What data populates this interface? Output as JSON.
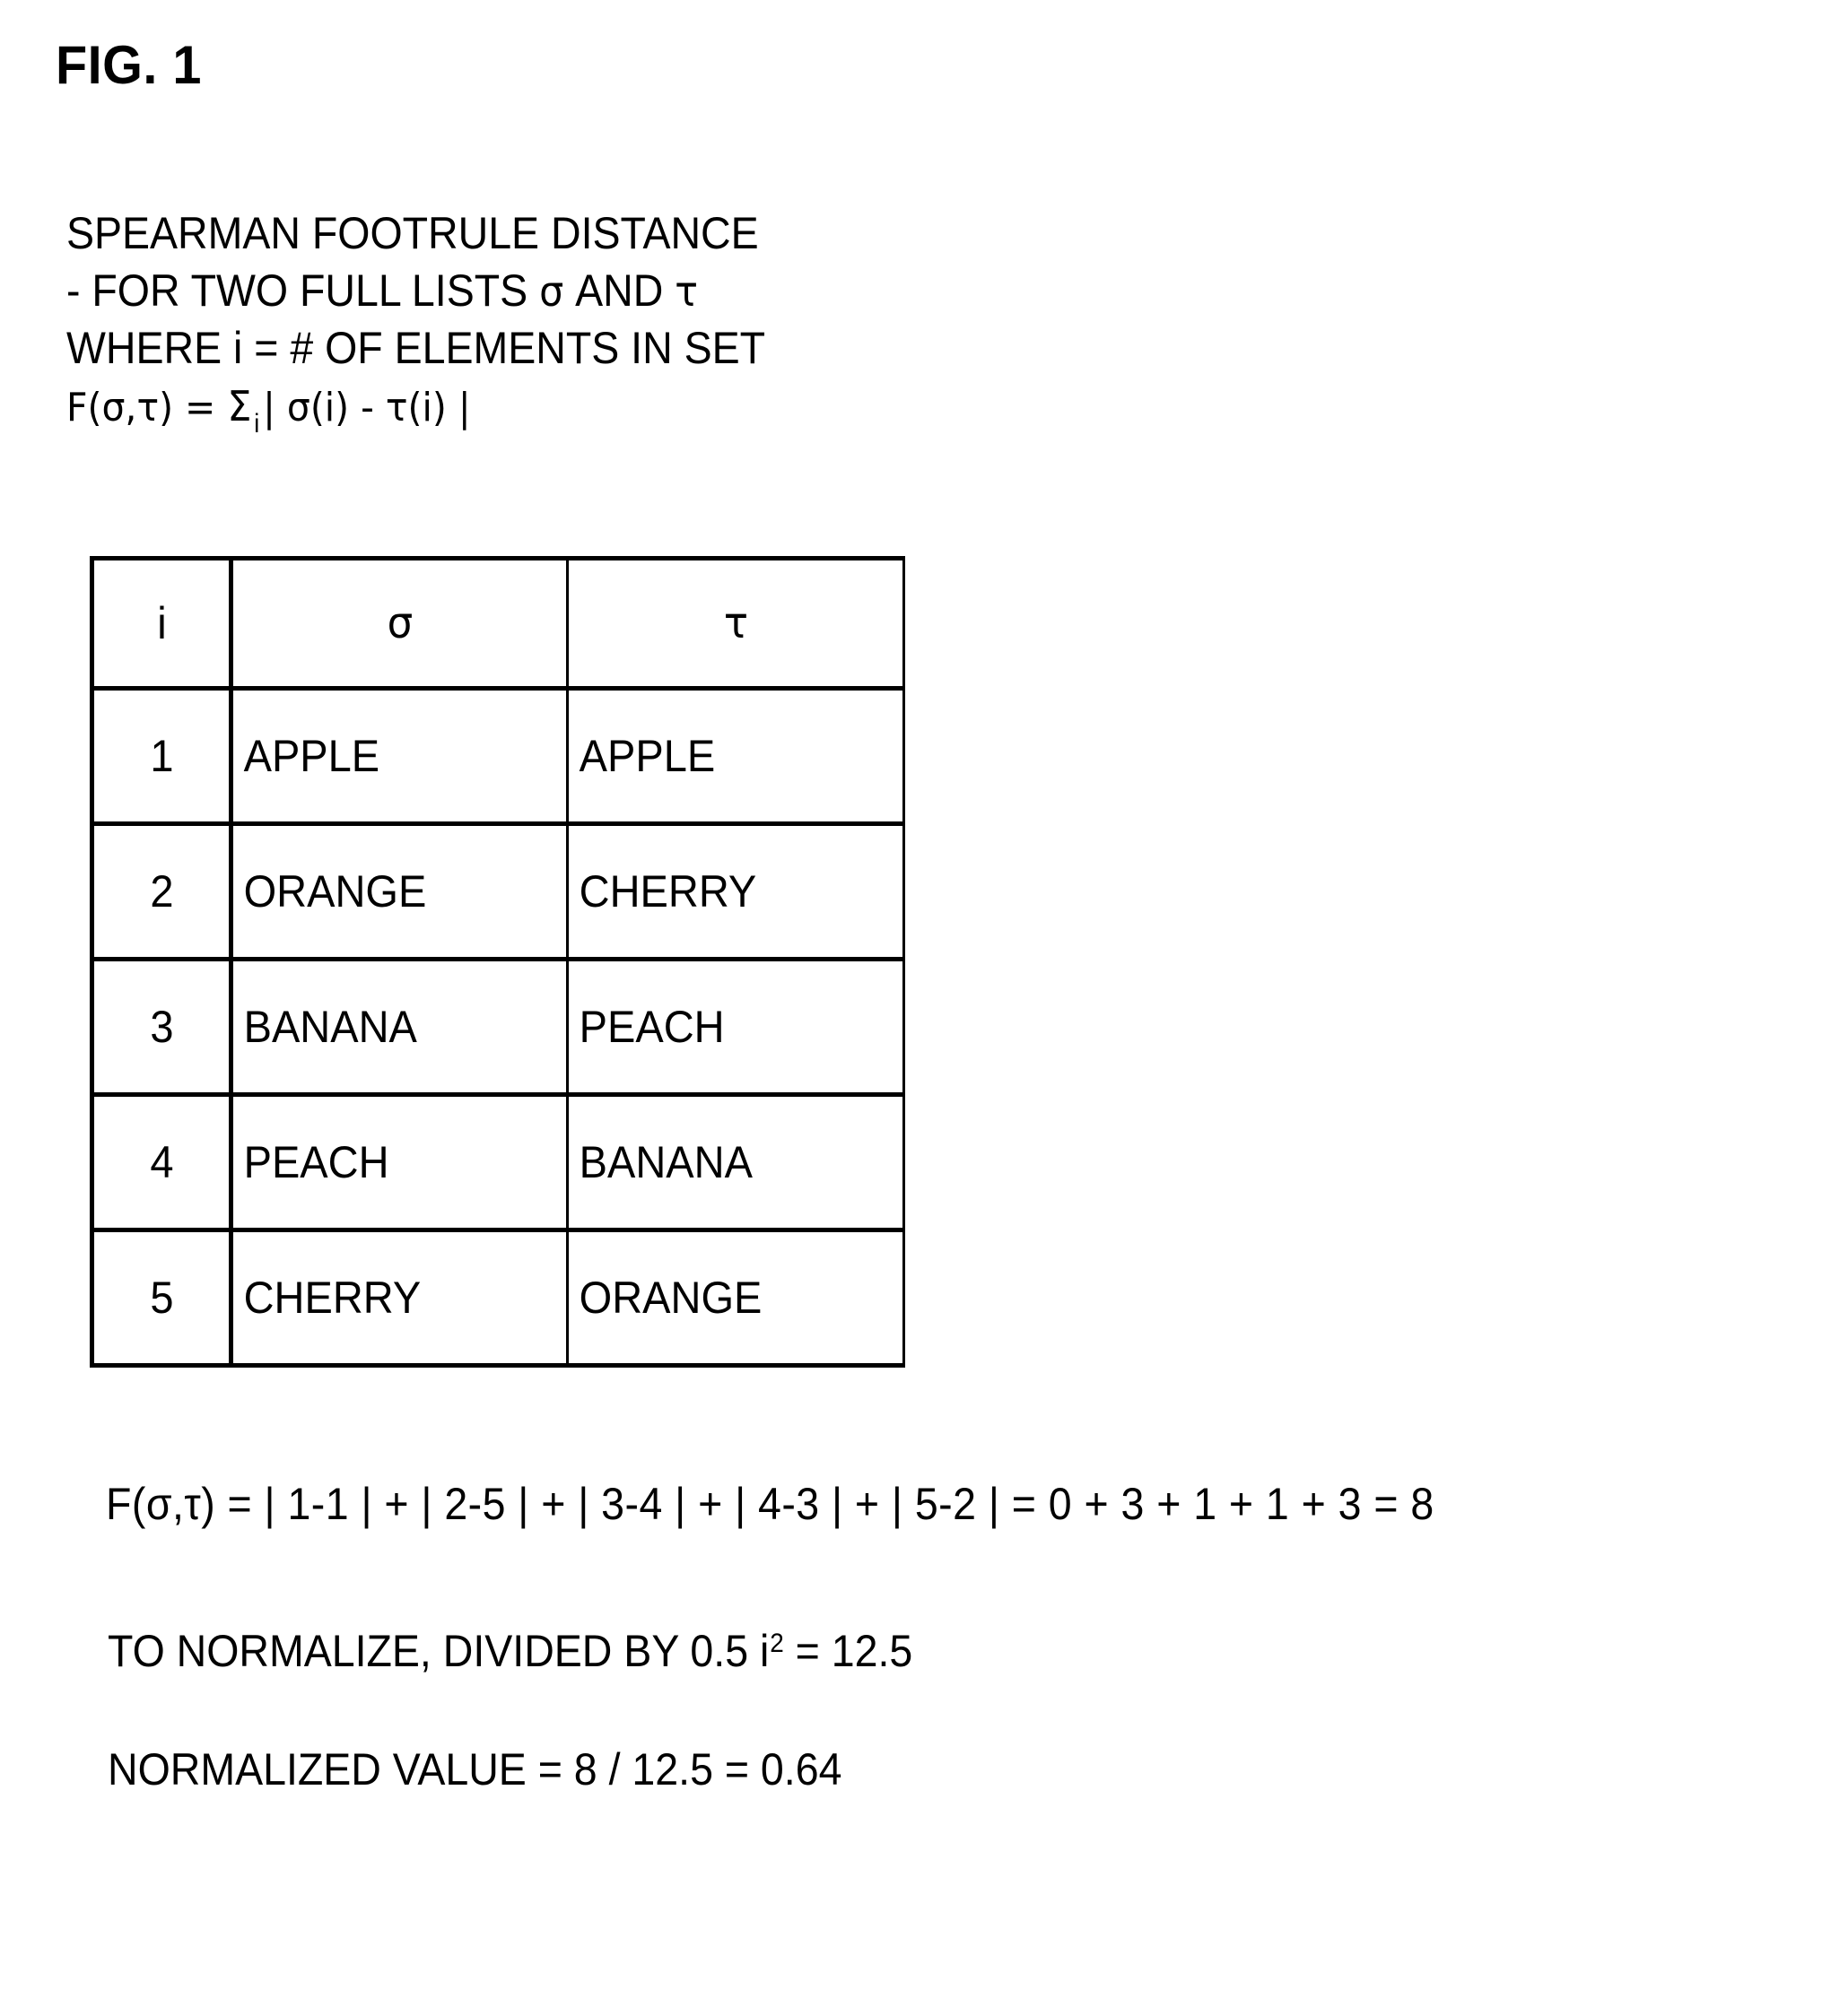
{
  "figure": {
    "title": "FIG. 1"
  },
  "description": {
    "line1": "SPEARMAN FOOTRULE DISTANCE",
    "line2_prefix": "- FOR TWO FULL LISTS ",
    "line2_sigma": "σ",
    "line2_mid": " AND ",
    "line2_tau": "τ",
    "line3": "WHERE  i = # OF ELEMENTS IN SET",
    "formula": {
      "fn": "F(σ,τ) = ",
      "sum": "Σ",
      "sub": "i",
      "body": "| σ(i) - τ(i) |"
    }
  },
  "table": {
    "headers": {
      "i": "i",
      "sigma": "σ",
      "tau": "τ"
    },
    "rows": [
      {
        "i": "1",
        "sigma": "APPLE",
        "tau": "APPLE"
      },
      {
        "i": "2",
        "sigma": "ORANGE",
        "tau": "CHERRY"
      },
      {
        "i": "3",
        "sigma": "BANANA",
        "tau": "PEACH"
      },
      {
        "i": "4",
        "sigma": "PEACH",
        "tau": "BANANA"
      },
      {
        "i": "5",
        "sigma": "CHERRY",
        "tau": "ORANGE"
      }
    ]
  },
  "equations": {
    "footrule": "F(σ,τ) = | 1-1 | + | 2-5 | + | 3-4 | + | 4-3 | + | 5-2 | = 0 + 3 + 1 + 1 + 3 = 8",
    "normalize_prefix": "TO NORMALIZE, DIVIDED BY 0.5 i",
    "normalize_exp": "2",
    "normalize_suffix": " = 12.5",
    "normalized_value": "NORMALIZED VALUE = 8 / 12.5 = 0.64"
  },
  "chart_data": {
    "type": "table",
    "title": "SPEARMAN FOOTRULE DISTANCE",
    "columns": [
      "i",
      "σ",
      "τ"
    ],
    "rows": [
      [
        "1",
        "APPLE",
        "APPLE"
      ],
      [
        "2",
        "ORANGE",
        "CHERRY"
      ],
      [
        "3",
        "BANANA",
        "PEACH"
      ],
      [
        "4",
        "PEACH",
        "BANANA"
      ],
      [
        "5",
        "CHERRY",
        "ORANGE"
      ]
    ],
    "displacements": [
      0,
      3,
      1,
      1,
      3
    ],
    "footrule_distance": 8,
    "normalizer": 12.5,
    "normalized_value": 0.64
  },
  "colors": {
    "ink": "#000000",
    "paper": "#ffffff"
  }
}
